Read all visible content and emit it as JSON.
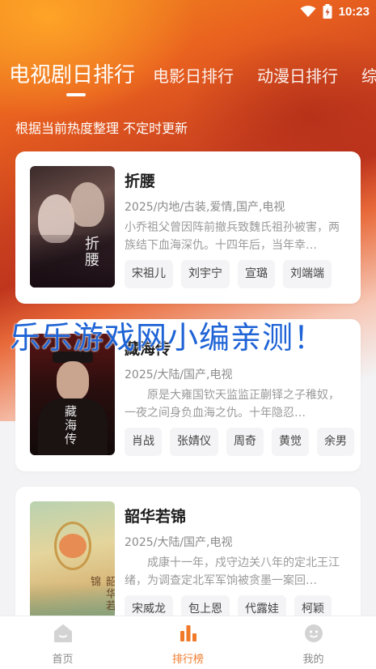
{
  "status_bar": {
    "time": "10:23"
  },
  "tabs": [
    {
      "label": "电视剧日排行",
      "active": true
    },
    {
      "label": "电影日排行",
      "active": false
    },
    {
      "label": "动漫日排行",
      "active": false
    },
    {
      "label": "综",
      "active": false
    }
  ],
  "subtitle": "根据当前热度整理 不定时更新",
  "shows": [
    {
      "title": "折腰",
      "meta": "2025/内地/古装,爱情,国产,电视",
      "desc": "小乔祖父曾因阵前撤兵致魏氏祖孙被害，两族结下血海深仇。十四年后，当年幸…",
      "tags": [
        "宋祖儿",
        "刘宇宁",
        "宣璐",
        "刘端端"
      ],
      "poster_title": "折腰"
    },
    {
      "title": "藏海传",
      "meta": "2025/大陆/国产,电视",
      "desc": "原是大雍国钦天监监正蒯铎之子稚奴，一夜之间身负血海之仇。十年隐忍…",
      "tags": [
        "肖战",
        "张婧仪",
        "周奇",
        "黄觉",
        "余男"
      ],
      "poster_title": "藏海传"
    },
    {
      "title": "韶华若锦",
      "meta": "2025/大陆/国产,电视",
      "desc": "成康十一年，戍守边关八年的定北王江绪，为调查定北军军饷被贪墨一案回…",
      "tags": [
        "宋威龙",
        "包上恩",
        "代露娃",
        "柯颖"
      ],
      "poster_title": "韶华若锦"
    }
  ],
  "watermark": "乐乐游戏网小编亲测！",
  "bottom_nav": [
    {
      "label": "首页",
      "icon": "home-icon",
      "active": false
    },
    {
      "label": "排行榜",
      "icon": "ranking-icon",
      "active": true
    },
    {
      "label": "我的",
      "icon": "profile-icon",
      "active": false
    }
  ],
  "colors": {
    "accent": "#f07a2a",
    "watermark": "#1e63d6"
  }
}
